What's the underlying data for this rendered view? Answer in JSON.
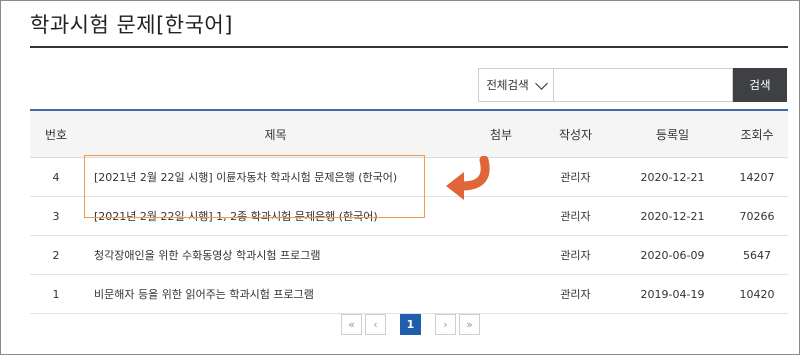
{
  "page": {
    "title": "학과시험 문제[한국어]"
  },
  "search": {
    "scope_label": "전체검색",
    "input_value": "",
    "button_label": "검색"
  },
  "table": {
    "headers": {
      "num": "번호",
      "title": "제목",
      "attachment": "첨부",
      "author": "작성자",
      "date": "등록일",
      "views": "조회수"
    },
    "rows": [
      {
        "num": "4",
        "title": "[2021년 2월 22일 시행] 이륜자동차 학과시험 문제은행 (한국어)",
        "attachment": "",
        "author": "관리자",
        "date": "2020-12-21",
        "views": "14207"
      },
      {
        "num": "3",
        "title": "[2021년 2월 22일 시행] 1, 2종 학과시험 문제은행 (한국어)",
        "attachment": "",
        "author": "관리자",
        "date": "2020-12-21",
        "views": "70266"
      },
      {
        "num": "2",
        "title": "청각장애인을 위한 수화동영상 학과시험 프로그램",
        "attachment": "",
        "author": "관리자",
        "date": "2020-06-09",
        "views": "5647"
      },
      {
        "num": "1",
        "title": "비문해자 등을 위한 읽어주는 학과시험 프로그램",
        "attachment": "",
        "author": "관리자",
        "date": "2019-04-19",
        "views": "10420"
      }
    ]
  },
  "pagination": {
    "first": "«",
    "prev": "‹",
    "current": "1",
    "next": "›",
    "last": "»"
  },
  "annotation": {
    "highlight_color": "#f3994a",
    "arrow_color": "#e0663a",
    "arrow_icon": "curved-arrow-left-icon"
  },
  "colors": {
    "accent": "#3c6da6",
    "active_page": "#1f5eab",
    "search_button": "#3f4043"
  }
}
